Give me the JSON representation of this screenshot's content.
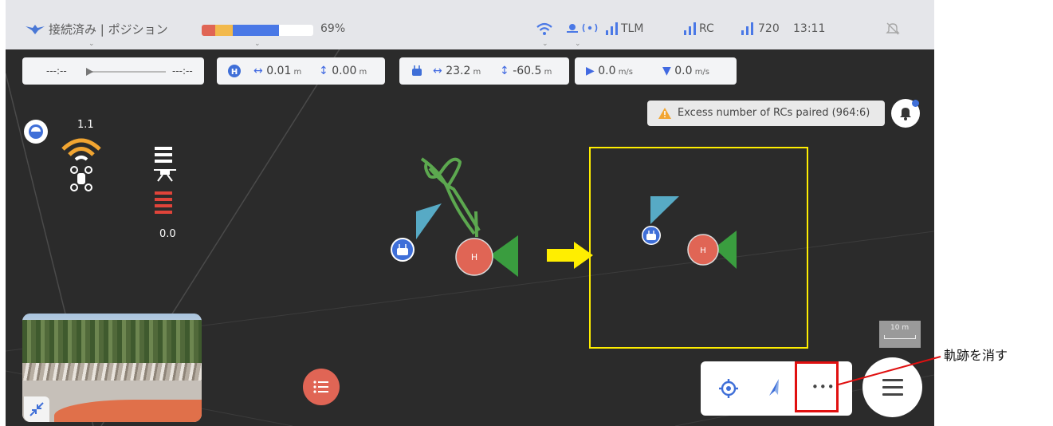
{
  "status_bar": {
    "connection_label": "接続済み | ポジション",
    "battery_percent": "69%",
    "battery_fraction": 0.69,
    "tlm_label": "TLM",
    "rc_label": "RC",
    "resolution": "720",
    "time": "13:11"
  },
  "timeline": {
    "start": "---:--",
    "end": "---:--"
  },
  "home_distance": {
    "horizontal": "0.01",
    "horizontal_unit": "m",
    "vertical": "0.00",
    "vertical_unit": "m"
  },
  "rc_distance": {
    "horizontal": "23.2",
    "horizontal_unit": "m",
    "vertical": "-60.5",
    "vertical_unit": "m"
  },
  "speed": {
    "horizontal": "0.0",
    "horizontal_unit": "m/s",
    "vertical": "0.0",
    "vertical_unit": "m/s"
  },
  "alert": {
    "message": "Excess number of RCs paired (964:6)"
  },
  "left_panel": {
    "signal_value": "1.1",
    "altitude_value": "0.0"
  },
  "map": {
    "home_label_1": "H",
    "home_label_2": "H"
  },
  "scale": {
    "label": "10 m"
  },
  "controls": {
    "more_label": "•••"
  },
  "annotation": {
    "text": "軌跡を消す"
  },
  "colors": {
    "accent_blue": "#3f6fd8",
    "home_red": "#e06555",
    "highlight_yellow": "#ffee00",
    "annotation_red": "#e01010"
  },
  "icons": [
    "drone-icon",
    "wifi-icon",
    "satellite-icon",
    "signal-bars-icon",
    "mute-icon",
    "home-icon",
    "rc-icon",
    "bell-icon",
    "warning-icon",
    "location-target-icon",
    "compass-arrow-icon",
    "list-icon",
    "collapse-icon",
    "hamburger-icon"
  ]
}
